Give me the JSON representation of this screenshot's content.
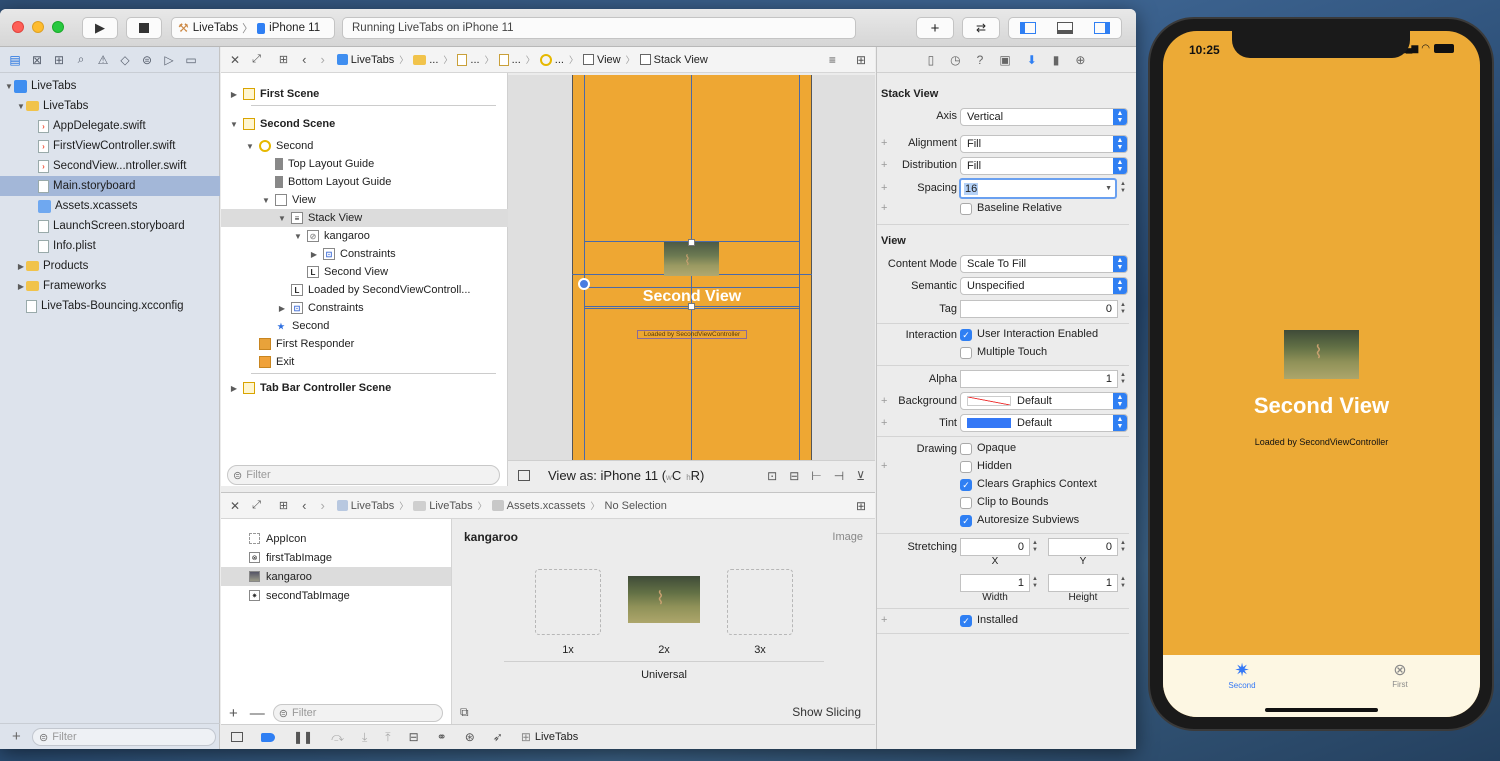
{
  "toolbar": {
    "scheme": "LiveTabs",
    "device": "iPhone 11",
    "status": "Running LiveTabs on iPhone 11"
  },
  "navigator": {
    "items": [
      {
        "label": "LiveTabs",
        "level": 0,
        "kind": "project"
      },
      {
        "label": "LiveTabs",
        "level": 1,
        "kind": "folder"
      },
      {
        "label": "AppDelegate.swift",
        "level": 2,
        "kind": "swift"
      },
      {
        "label": "FirstViewController.swift",
        "level": 2,
        "kind": "swift"
      },
      {
        "label": "SecondView...ntroller.swift",
        "level": 2,
        "kind": "swift"
      },
      {
        "label": "Main.storyboard",
        "level": 2,
        "kind": "storyboard"
      },
      {
        "label": "Assets.xcassets",
        "level": 2,
        "kind": "assets"
      },
      {
        "label": "LaunchScreen.storyboard",
        "level": 2,
        "kind": "storyboard"
      },
      {
        "label": "Info.plist",
        "level": 2,
        "kind": "plist"
      },
      {
        "label": "Products",
        "level": 1,
        "kind": "folder"
      },
      {
        "label": "Frameworks",
        "level": 1,
        "kind": "folder"
      },
      {
        "label": "LiveTabs-Bouncing.xcconfig",
        "level": 1,
        "kind": "file"
      }
    ],
    "filter_placeholder": "Filter"
  },
  "editor": {
    "breadcrumb": [
      "LiveTabs",
      "...",
      "...",
      "...",
      "...",
      "View",
      "Stack View"
    ],
    "outline": [
      {
        "label": "First Scene",
        "level": 0,
        "bold": true
      },
      {
        "label": "Second Scene",
        "level": 0,
        "bold": true
      },
      {
        "label": "Second",
        "level": 1
      },
      {
        "label": "Top Layout Guide",
        "level": 2
      },
      {
        "label": "Bottom Layout Guide",
        "level": 2
      },
      {
        "label": "View",
        "level": 2
      },
      {
        "label": "Stack View",
        "level": 3
      },
      {
        "label": "kangaroo",
        "level": 4
      },
      {
        "label": "Constraints",
        "level": 5
      },
      {
        "label": "Second View",
        "level": 4
      },
      {
        "label": "Loaded by SecondViewControll...",
        "level": 3
      },
      {
        "label": "Constraints",
        "level": 3
      },
      {
        "label": "Second",
        "level": 2
      },
      {
        "label": "First Responder",
        "level": 1
      },
      {
        "label": "Exit",
        "level": 1
      },
      {
        "label": "Tab Bar Controller Scene",
        "level": 0,
        "bold": true
      }
    ],
    "filter_placeholder": "Filter",
    "canvas_title": "Second View",
    "canvas_subtitle": "Loaded by SecondViewController",
    "view_as": "View as: iPhone 11 (",
    "view_as_c": "C",
    "view_as_r": "R)"
  },
  "assets": {
    "breadcrumb": [
      "LiveTabs",
      "LiveTabs",
      "Assets.xcassets",
      "No Selection"
    ],
    "list": [
      "AppIcon",
      "firstTabImage",
      "kangaroo",
      "secondTabImage"
    ],
    "title": "kangaroo",
    "type": "Image",
    "slots": [
      "1x",
      "2x",
      "3x"
    ],
    "universal": "Universal",
    "show_slicing": "Show Slicing",
    "filter_placeholder": "Filter"
  },
  "inspector": {
    "stack_header": "Stack View",
    "axis_label": "Axis",
    "axis_value": "Vertical",
    "alignment_label": "Alignment",
    "alignment_value": "Fill",
    "distribution_label": "Distribution",
    "distribution_value": "Fill",
    "spacing_label": "Spacing",
    "spacing_value": "16",
    "baseline_label": "Baseline Relative",
    "view_header": "View",
    "content_mode_label": "Content Mode",
    "content_mode_value": "Scale To Fill",
    "semantic_label": "Semantic",
    "semantic_value": "Unspecified",
    "tag_label": "Tag",
    "tag_value": "0",
    "interaction_label": "Interaction",
    "user_interaction_label": "User Interaction Enabled",
    "multiple_touch_label": "Multiple Touch",
    "alpha_label": "Alpha",
    "alpha_value": "1",
    "background_label": "Background",
    "background_value": "Default",
    "tint_label": "Tint",
    "tint_value": "Default",
    "drawing_label": "Drawing",
    "opaque_label": "Opaque",
    "hidden_label": "Hidden",
    "clears_label": "Clears Graphics Context",
    "clip_label": "Clip to Bounds",
    "autoresize_label": "Autoresize Subviews",
    "stretching_label": "Stretching",
    "stretch_x": "0",
    "stretch_y": "0",
    "stretch_w": "1",
    "stretch_h": "1",
    "x_label": "X",
    "y_label": "Y",
    "width_label": "Width",
    "height_label": "Height",
    "installed_label": "Installed"
  },
  "bottombar": {
    "target": "LiveTabs",
    "filter_placeholder": "Filter"
  },
  "phone": {
    "time": "10:25",
    "title": "Second View",
    "subtitle": "Loaded by SecondViewController",
    "tab_second": "Second",
    "tab_first": "First"
  },
  "colors": {
    "accent": "#2f7ff3",
    "canvas_orange": "#eea733",
    "phone_orange": "#ecaa36",
    "selection": "#a3b7d8"
  }
}
